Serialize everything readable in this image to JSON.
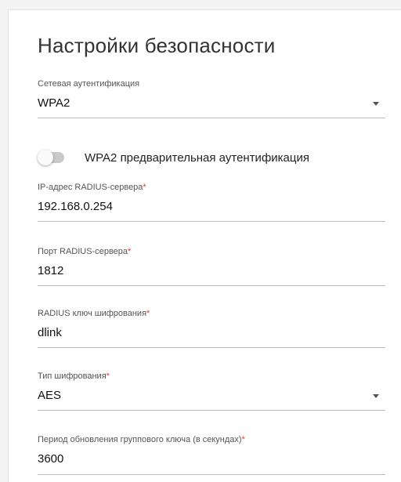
{
  "section": {
    "title": "Настройки безопасности"
  },
  "fields": {
    "network_auth": {
      "label": "Сетевая аутентификация",
      "value": "WPA2"
    },
    "preauth": {
      "label": "WPA2 предварительная аутентификация",
      "enabled": false
    },
    "radius_ip": {
      "label": "IP-адрес RADIUS-сервера",
      "required": "*",
      "value": "192.168.0.254"
    },
    "radius_port": {
      "label": "Порт RADIUS-сервера",
      "required": "*",
      "value": "1812"
    },
    "radius_key": {
      "label": "RADIUS ключ шифрования",
      "required": "*",
      "value": "dlink"
    },
    "encryption_type": {
      "label": "Тип шифрования",
      "required": "*",
      "value": "AES"
    },
    "group_key_period": {
      "label": "Период обновления группового ключа (в секундах)",
      "required": "*",
      "value": "3600"
    }
  },
  "colors": {
    "required_mark": "#e53935",
    "underline": "#bdbdbd",
    "toggle_off_track": "#c9c9c9"
  },
  "icons": {
    "dropdown": "chevron-down-icon"
  }
}
